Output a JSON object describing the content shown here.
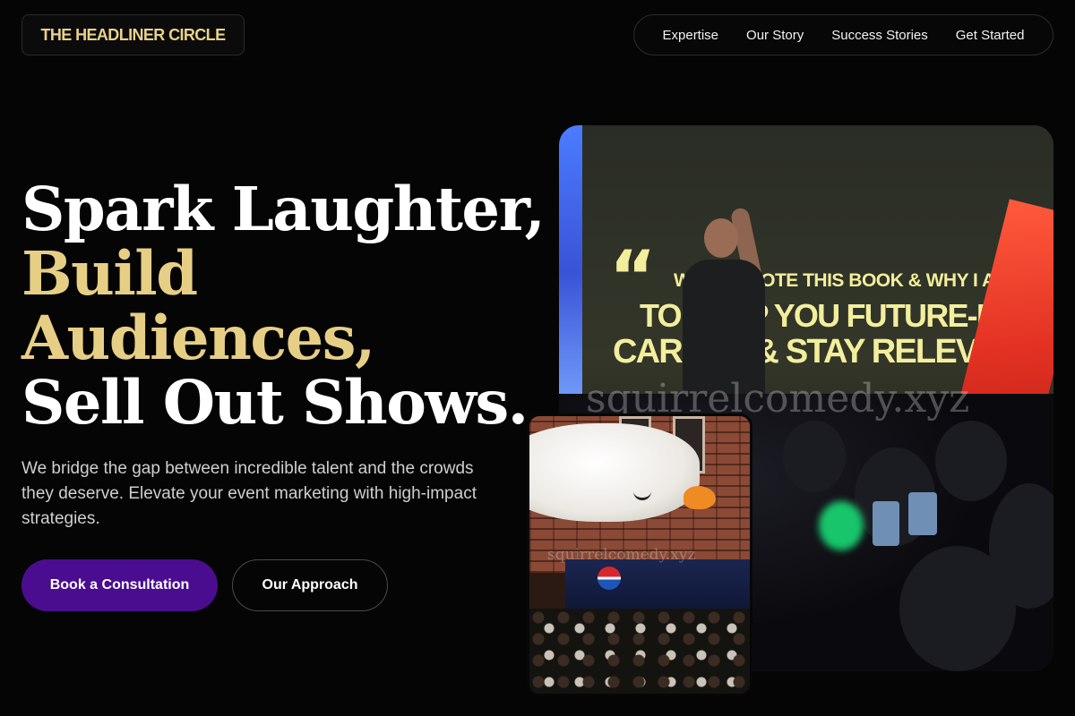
{
  "header": {
    "logo": "THE HEADLINER CIRCLE",
    "nav": [
      "Expertise",
      "Our Story",
      "Success Stories",
      "Get Started"
    ]
  },
  "hero": {
    "headline": {
      "line1": "Spark Laughter,",
      "line2": "Build",
      "line3": "Audiences,",
      "line4": "Sell Out Shows."
    },
    "subcopy": "We bridge the gap between incredible talent and the crowds they deserve. Elevate your event marketing with high-impact strategies.",
    "primary_button": "Book a Consultation",
    "secondary_button": "Our Approach"
  },
  "images": {
    "stage_photo": {
      "screen_line1": "WHY I WROTE THIS BOOK & WHY I AM HERE...",
      "screen_line2": "TO HELP YOU FUTURE-PROOF YOUR",
      "screen_line3": "CAREER & STAY RELEVANT.",
      "watermark": "squirrelcomedy.xyz"
    },
    "parade_photo": {
      "watermark": "squirrelcomedy.xyz",
      "sign": "PEPSI"
    }
  },
  "colors": {
    "accent_gold": "#e6cf85",
    "primary_purple": "#4a0d8f",
    "background": "#050505"
  }
}
